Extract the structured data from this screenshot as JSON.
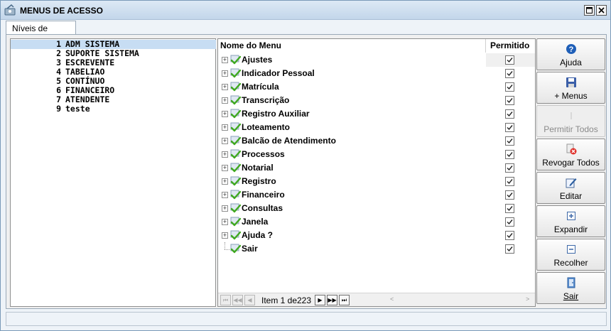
{
  "window": {
    "title": "MENUS DE ACESSO"
  },
  "tabs": [
    {
      "label": "Níveis de Acesso"
    }
  ],
  "levels": [
    {
      "num": "1",
      "name": "ADM SISTEMA"
    },
    {
      "num": "2",
      "name": "SUPORTE SISTEMA"
    },
    {
      "num": "3",
      "name": "ESCREVENTE"
    },
    {
      "num": "4",
      "name": "TABELIAO"
    },
    {
      "num": "5",
      "name": "CONTÍNUO"
    },
    {
      "num": "6",
      "name": "FINANCEIRO"
    },
    {
      "num": "7",
      "name": "ATENDENTE"
    },
    {
      "num": "9",
      "name": "teste"
    }
  ],
  "menu_table": {
    "columns": {
      "name": "Nome do Menu",
      "permitted": "Permitido"
    },
    "rows": [
      {
        "label": "Ajustes",
        "expandable": true,
        "checked": true
      },
      {
        "label": "Indicador Pessoal",
        "expandable": true,
        "checked": true
      },
      {
        "label": "Matrícula",
        "expandable": true,
        "checked": true
      },
      {
        "label": "Transcrição",
        "expandable": true,
        "checked": true
      },
      {
        "label": "Registro Auxiliar",
        "expandable": true,
        "checked": true
      },
      {
        "label": "Loteamento",
        "expandable": true,
        "checked": true
      },
      {
        "label": "Balcão de Atendimento",
        "expandable": true,
        "checked": true
      },
      {
        "label": "Processos",
        "expandable": true,
        "checked": true
      },
      {
        "label": "Notarial",
        "expandable": true,
        "checked": true
      },
      {
        "label": "Registro",
        "expandable": true,
        "checked": true
      },
      {
        "label": "Financeiro",
        "expandable": true,
        "checked": true
      },
      {
        "label": "Consultas",
        "expandable": true,
        "checked": true
      },
      {
        "label": "Janela",
        "expandable": true,
        "checked": true
      },
      {
        "label": "Ajuda ?",
        "expandable": true,
        "checked": true
      },
      {
        "label": "Sair",
        "expandable": false,
        "checked": true
      }
    ]
  },
  "pager": {
    "item_label": "Item 1 de",
    "total": "223"
  },
  "buttons": {
    "help": "Ajuda",
    "add_menus": "+ Menus",
    "allow_all": "Permitir Todos",
    "revoke_all": "Revogar Todos",
    "edit": "Editar",
    "expand": "Expandir",
    "collapse": "Recolher",
    "exit": "Sair"
  },
  "colors": {
    "selection": "#c7ddf3",
    "check_green": "#3fa91f",
    "help_blue": "#1f5fb8",
    "revoke_red": "#e0302a"
  }
}
